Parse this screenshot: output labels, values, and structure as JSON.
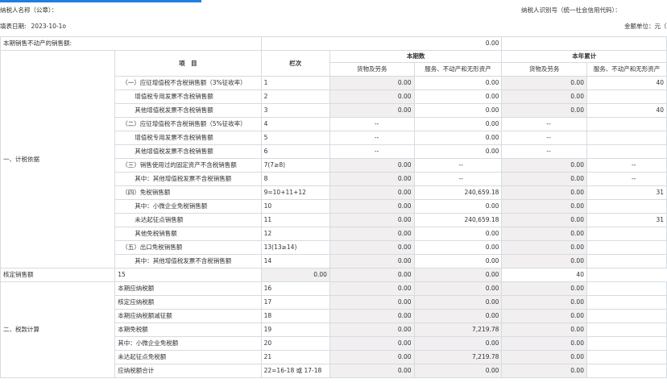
{
  "header": {
    "taxpayer_name_label": "纳税人名称（公章）：",
    "taxpayer_id_label": "纳税人识别号（统一社会信用代码）：",
    "date_label": "填表日期:",
    "date_value": "2023-10-1o",
    "unit_label": "金额单位：元（列"
  },
  "table": {
    "top_row": {
      "label": "本期销售不动产的销售额:",
      "value": "0.00"
    },
    "col_item": "项　目",
    "col_line": "栏次",
    "group_current": "本期数",
    "group_ytd": "本年累计",
    "sub_goods": "货物及劳务",
    "sub_services": "服务、不动产和无形资产",
    "sections": {
      "s1": "一、计税依据",
      "s2": "二、税款计算"
    },
    "rows": [
      {
        "item": "（一）应征增值税不含税销售额（3%征收率）",
        "line": "1",
        "c1": "0.00",
        "c2": "0.00",
        "c3": "0.00",
        "c4": "40",
        "lvl": 1
      },
      {
        "item": "增值税专用发票不含税销售额",
        "line": "2",
        "c1": "0.00",
        "c2": "0.00",
        "c3": "0.00",
        "c4": "",
        "lvl": 2
      },
      {
        "item": "其他增值税发票不含税销售额",
        "line": "3",
        "c1": "0.00",
        "c2": "0.00",
        "c3": "0.00",
        "c4": "40",
        "lvl": 2
      },
      {
        "item": "（二）应征增值税不含税销售额（5%征收率）",
        "line": "4",
        "c1": "--",
        "c2": "0.00",
        "c3": "--",
        "c4": "",
        "lvl": 1
      },
      {
        "item": "增值税专用发票不含税销售额",
        "line": "5",
        "c1": "--",
        "c2": "0.00",
        "c3": "--",
        "c4": "",
        "lvl": 2
      },
      {
        "item": "其他增值税发票不含税销售额",
        "line": "6",
        "c1": "--",
        "c2": "0.00",
        "c3": "--",
        "c4": "",
        "lvl": 2
      },
      {
        "item": "（三）销售使用过的固定资产不含税销售额",
        "line": "7(7≥8)",
        "c1": "0.00",
        "c2": "--",
        "c3": "0.00",
        "c4": "--",
        "lvl": 1
      },
      {
        "item": "其中：其他增值税发票不含税销售额",
        "line": "8",
        "c1": "0.00",
        "c2": "--",
        "c3": "0.00",
        "c4": "--",
        "lvl": 2
      },
      {
        "item": "（四）免税销售额",
        "line": "9=10+11+12",
        "c1": "0.00",
        "c2": "240,659.18",
        "c3": "0.00",
        "c4": "31",
        "lvl": 1
      },
      {
        "item": "其中：小微企业免税销售额",
        "line": "10",
        "c1": "0.00",
        "c2": "0.00",
        "c3": "0.00",
        "c4": "",
        "lvl": 2
      },
      {
        "item": "未达起征点销售额",
        "line": "11",
        "c1": "0.00",
        "c2": "240,659.18",
        "c3": "0.00",
        "c4": "31",
        "lvl": 2
      },
      {
        "item": "其他免税销售额",
        "line": "12",
        "c1": "0.00",
        "c2": "0.00",
        "c3": "0.00",
        "c4": "",
        "lvl": 2
      },
      {
        "item": "（五）出口免税销售额",
        "line": "13(13≥14)",
        "c1": "0.00",
        "c2": "0.00",
        "c3": "0.00",
        "c4": "",
        "lvl": 1
      },
      {
        "item": "其中：其他增值税发票不含税销售额",
        "line": "14",
        "c1": "0.00",
        "c2": "0.00",
        "c3": "0.00",
        "c4": "",
        "lvl": 2
      },
      {
        "item": "核定销售额",
        "line": "15",
        "c1": "0.00",
        "c2": "0.00",
        "c3": "0.00",
        "c4": "40",
        "lvl": 0
      },
      {
        "item": "本期应纳税额",
        "line": "16",
        "c1": "0.00",
        "c2": "0.00",
        "c3": "0.00",
        "c4": "",
        "lvl": 0
      },
      {
        "item": "核定应纳税额",
        "line": "17",
        "c1": "0.00",
        "c2": "0.00",
        "c3": "0.00",
        "c4": "",
        "lvl": 0
      },
      {
        "item": "本期应纳税额减征额",
        "line": "18",
        "c1": "0.00",
        "c2": "0.00",
        "c3": "0.00",
        "c4": "",
        "lvl": 0
      },
      {
        "item": "本期免税额",
        "line": "19",
        "c1": "0.00",
        "c2": "7,219.78",
        "c3": "0.00",
        "c4": "",
        "lvl": 0
      },
      {
        "item": "其中：小微企业免税额",
        "line": "20",
        "c1": "0.00",
        "c2": "0.00",
        "c3": "0.00",
        "c4": "",
        "lvl": 0
      },
      {
        "item": "未达起征点免税额",
        "line": "21",
        "c1": "0.00",
        "c2": "7,219.78",
        "c3": "0.00",
        "c4": "",
        "lvl": 0
      },
      {
        "item": "应纳税额合计",
        "line": "22=16-18 或 17-18",
        "c1": "0.00",
        "c2": "0.00",
        "c3": "0.00",
        "c4": "",
        "lvl": 0
      }
    ]
  }
}
